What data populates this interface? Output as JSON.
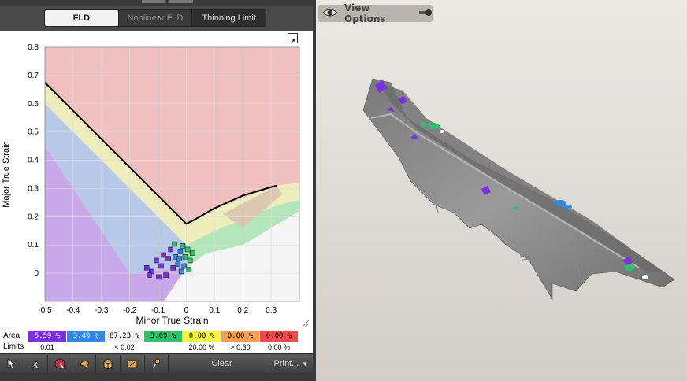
{
  "tabs": [
    {
      "label": "FLD",
      "state": "active"
    },
    {
      "label": "Nonlinear FLD",
      "state": "disabled"
    },
    {
      "label": "Thinning Limit",
      "state": "normal"
    }
  ],
  "chart_data": {
    "type": "scatter",
    "xlabel": "Minor True Strain",
    "ylabel": "Major True Strain",
    "xlim": [
      -0.5,
      0.4
    ],
    "ylim": [
      -0.1,
      0.8
    ],
    "x_ticks": [
      "-0.5",
      "-0.4",
      "-0.3",
      "-0.2",
      "-0.1",
      "0",
      "0.1",
      "0.2",
      "0.3"
    ],
    "y_ticks": [
      "0",
      "0.1",
      "0.2",
      "0.3",
      "0.4",
      "0.5",
      "0.6",
      "0.7",
      "0.8"
    ],
    "grid": true,
    "fld_curve": {
      "x": [
        -0.5,
        0.0,
        0.03,
        0.1,
        0.2,
        0.3,
        0.32
      ],
      "y": [
        0.675,
        0.175,
        0.19,
        0.23,
        0.275,
        0.305,
        0.31
      ]
    },
    "points_cluster": {
      "x_range": [
        -0.14,
        0.03
      ],
      "y_range": [
        -0.02,
        0.11
      ]
    },
    "region_colors": {
      "failure": "#f0c0c0",
      "marginal": "#eeeebc",
      "safe": "#b3e7b9",
      "compression": "#b8c8e8",
      "wrinkling": "#c8a8e8",
      "low_strain": "#f5f5f5",
      "biaxial": "#dcc8b0"
    }
  },
  "legend": {
    "area_label": "Area",
    "limits_label": "Limits",
    "areas": [
      {
        "value": "5.59 %",
        "color": "#7b2fe0",
        "text_color": "#ffffff"
      },
      {
        "value": "3.49 %",
        "color": "#2e86e8",
        "text_color": "#ffffff"
      },
      {
        "value": "87.23 %",
        "color": "#f0f0f0",
        "text_color": "#000000"
      },
      {
        "value": "3.69 %",
        "color": "#2ec36b",
        "text_color": "#000000"
      },
      {
        "value": "0.00 %",
        "color": "#f5f53a",
        "text_color": "#000000"
      },
      {
        "value": "0.00 %",
        "color": "#f5a050",
        "text_color": "#000000"
      },
      {
        "value": "0.00 %",
        "color": "#f24a4a",
        "text_color": "#000000"
      }
    ],
    "limits": [
      "0.01",
      "< 0.02",
      "20.00 %",
      "> 0.30",
      "0.00 %"
    ]
  },
  "toolbar": {
    "tools": [
      "select-tool-icon",
      "probe-tool-icon",
      "record-icon",
      "section-icon",
      "cube-icon",
      "erase-icon",
      "pin-icon"
    ],
    "clear_label": "Clear",
    "print_label": "Print..."
  },
  "viewport": {
    "view_options_label": "View Options"
  }
}
